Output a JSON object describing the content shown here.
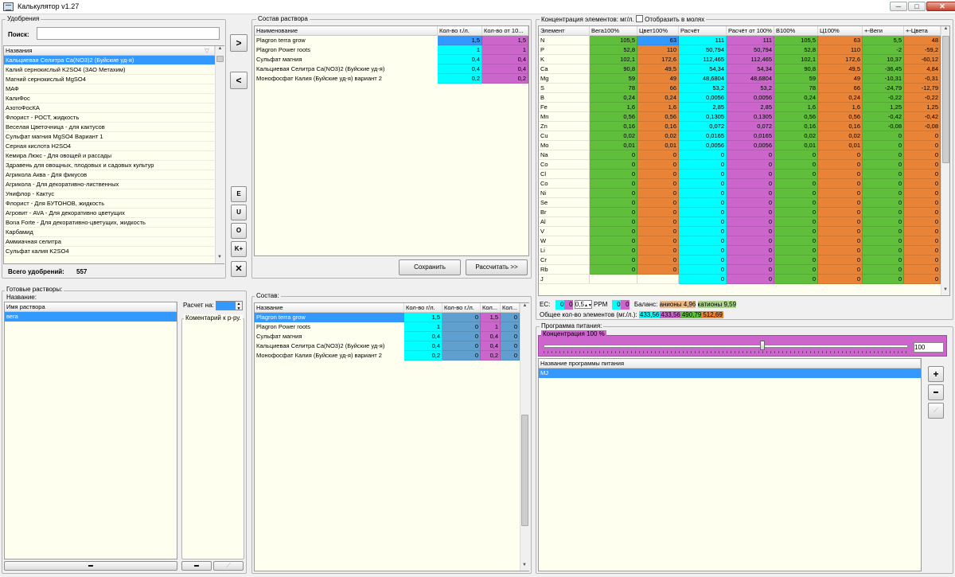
{
  "window": {
    "title": "Калькулятор v1.27",
    "btn_min": "─",
    "btn_max": "□",
    "btn_close": "✕"
  },
  "fert": {
    "group": "Удобрения",
    "search_label": "Поиск:",
    "search_value": "",
    "col": "Названия",
    "items": [
      "Кальциевая Селитра Ca(NO3)2 (Буйские уд-я)",
      "Калий сернокислый K2SO4 (ЗАО Метахим)",
      "Магний сернокислый MgSO4",
      "МАФ",
      "КалиФос",
      "АзотоФосКА",
      "Флорист - РОСТ, жидкость",
      "Веселая Цветочница - для кактусов",
      "Сульфат магния MgSO4 Вариант 1",
      "Серная кислота H2SO4",
      "Кемира Люкс - Для овощей и рассады",
      "Здравень для овощных, плодовых и садовых культур",
      "Агрикола Аква - Для фикусов",
      "Агрикола - Для декоративно-лиственных",
      "Унифлор - Кактус",
      "Флорист - Для БУТОНОВ, жидкость",
      "Агровит - AVA - Для декоративно цветущих",
      "Bona Forte - Для декоративно-цветущих, жидкость",
      "Карбамид",
      "Аммиачная селитра",
      "Сульфат калия K2SO4"
    ],
    "total_label": "Всего удобрений:",
    "total": "557"
  },
  "side_buttons": {
    "add": ">",
    "remove": "<",
    "e": "E",
    "u": "U",
    "o": "O",
    "k": "K+",
    "del": "✕"
  },
  "sostav": {
    "group": "Состав раствора",
    "col1": "Наименование",
    "col2": "Кол-во г./л.",
    "col3": "Кол-во от 10...",
    "rows": [
      {
        "name": "Plagron terra grow",
        "a": "1,5",
        "b": "1,5"
      },
      {
        "name": "Plagron Power roots",
        "a": "1",
        "b": "1"
      },
      {
        "name": "Сульфат магния",
        "a": "0,4",
        "b": "0,4"
      },
      {
        "name": "Кальциевая Селитра Ca(NO3)2 (Буйские уд-я)",
        "a": "0,4",
        "b": "0,4"
      },
      {
        "name": "Монофосфат Калия (Буйские уд-я) вариант 2",
        "a": "0,2",
        "b": "0,2"
      }
    ],
    "save": "Сохранить",
    "calc": "Рассчитать >>"
  },
  "conc": {
    "group": "Концентрация элементов: мг/л.",
    "moles_label": "Отобразить в молях",
    "cols": [
      "Элемент",
      "Вега100%",
      "Цвет100%",
      "Расчёт",
      "Расчёт от 100%",
      "В100%",
      "Ц100%",
      "+-Веги",
      "+-Цвета"
    ],
    "rows": [
      [
        "N",
        "105,5",
        "63",
        "111",
        "111",
        "105,5",
        "63",
        "5,5",
        "48"
      ],
      [
        "P",
        "52,8",
        "110",
        "50,794",
        "50,794",
        "52,8",
        "110",
        "-2",
        "-59,2"
      ],
      [
        "K",
        "102,1",
        "172,6",
        "112,465",
        "112,465",
        "102,1",
        "172,6",
        "10,37",
        "-60,12"
      ],
      [
        "Ca",
        "90,8",
        "49,5",
        "54,34",
        "54,34",
        "90,8",
        "49,5",
        "-36,45",
        "4,84"
      ],
      [
        "Mg",
        "59",
        "49",
        "48,6804",
        "48,6804",
        "59",
        "49",
        "-10,31",
        "-0,31"
      ],
      [
        "S",
        "78",
        "66",
        "53,2",
        "53,2",
        "78",
        "66",
        "-24,79",
        "-12,79"
      ],
      [
        "B",
        "0,24",
        "0,24",
        "0,0056",
        "0,0056",
        "0,24",
        "0,24",
        "-0,22",
        "-0,22"
      ],
      [
        "Fe",
        "1,6",
        "1,6",
        "2,85",
        "2,85",
        "1,6",
        "1,6",
        "1,25",
        "1,25"
      ],
      [
        "Mn",
        "0,56",
        "0,56",
        "0,1305",
        "0,1305",
        "0,56",
        "0,56",
        "-0,42",
        "-0,42"
      ],
      [
        "Zn",
        "0,16",
        "0,16",
        "0,072",
        "0,072",
        "0,16",
        "0,16",
        "-0,08",
        "-0,08"
      ],
      [
        "Cu",
        "0,02",
        "0,02",
        "0,0165",
        "0,0165",
        "0,02",
        "0,02",
        "0",
        "0"
      ],
      [
        "Mo",
        "0,01",
        "0,01",
        "0,0056",
        "0,0056",
        "0,01",
        "0,01",
        "0",
        "0"
      ],
      [
        "Na",
        "0",
        "0",
        "0",
        "0",
        "0",
        "0",
        "0",
        "0"
      ],
      [
        "Co",
        "0",
        "0",
        "0",
        "0",
        "0",
        "0",
        "0",
        "0"
      ],
      [
        "Cl",
        "0",
        "0",
        "0",
        "0",
        "0",
        "0",
        "0",
        "0"
      ],
      [
        "Co",
        "0",
        "0",
        "0",
        "0",
        "0",
        "0",
        "0",
        "0"
      ],
      [
        "Ni",
        "0",
        "0",
        "0",
        "0",
        "0",
        "0",
        "0",
        "0"
      ],
      [
        "Se",
        "0",
        "0",
        "0",
        "0",
        "0",
        "0",
        "0",
        "0"
      ],
      [
        "Br",
        "0",
        "0",
        "0",
        "0",
        "0",
        "0",
        "0",
        "0"
      ],
      [
        "Al",
        "0",
        "0",
        "0",
        "0",
        "0",
        "0",
        "0",
        "0"
      ],
      [
        "V",
        "0",
        "0",
        "0",
        "0",
        "0",
        "0",
        "0",
        "0"
      ],
      [
        "W",
        "0",
        "0",
        "0",
        "0",
        "0",
        "0",
        "0",
        "0"
      ],
      [
        "Li",
        "0",
        "0",
        "0",
        "0",
        "0",
        "0",
        "0",
        "0"
      ],
      [
        "Cr",
        "0",
        "0",
        "0",
        "0",
        "0",
        "0",
        "0",
        "0"
      ],
      [
        "Rb",
        "0",
        "0",
        "0",
        "0",
        "0",
        "0",
        "0",
        "0"
      ],
      [
        "J",
        "",
        "",
        "0",
        "0",
        "0",
        "0",
        "0",
        "0"
      ]
    ]
  },
  "ec": {
    "label": "EC:",
    "v1": "0",
    "v2": "0",
    "ppm_val": "0,5",
    "ppm_label": "PPM",
    "p1": "0",
    "p2": "0",
    "balance_label": "Баланс:",
    "anions": "анионы 4,96",
    "cations": "катионы 9,59",
    "total_label": "Общее кол-во элементов (мг./л.):",
    "t1": "433,56",
    "t2": "433,56",
    "t3": "490,79",
    "t4": "512,69"
  },
  "ready": {
    "group": "Готовые растворы:",
    "name_group": "Название:",
    "col": "Имя раствора",
    "items": [
      "вега"
    ],
    "calc_label": "Расчет на:",
    "calc_value": "",
    "comment_group": "Коментарий к р-ру.",
    "minus": "━",
    "minus2": "━",
    "extra": "⟋"
  },
  "sostav2": {
    "group": "Состав:",
    "cols": [
      "Название",
      "Кол-во г/л.",
      "Кол-во г./л.",
      "Кол...",
      "Кол..."
    ],
    "rows": [
      {
        "name": "Plagron terra grow",
        "a": "1,5",
        "b": "0",
        "c": "1,5",
        "d": "0"
      },
      {
        "name": "Plagron Power roots",
        "a": "1",
        "b": "0",
        "c": "1",
        "d": "0"
      },
      {
        "name": "Сульфат магния",
        "a": "0,4",
        "b": "0",
        "c": "0,4",
        "d": "0"
      },
      {
        "name": "Кальциевая Селитра Ca(NO3)2 (Буйские уд-я)",
        "a": "0,4",
        "b": "0",
        "c": "0,4",
        "d": "0"
      },
      {
        "name": "Монофосфат Калия (Буйские уд-я) вариант 2",
        "a": "0,2",
        "b": "0",
        "c": "0,2",
        "d": "0"
      }
    ]
  },
  "program": {
    "group": "Программа питания:",
    "conc_group": "Концентрация 100 %",
    "slider_value": "100",
    "slider_level": 0.6,
    "col": "Название программы питания",
    "items": [
      "MJ"
    ],
    "plus": "+",
    "minus": "━",
    "extra": "⟋"
  },
  "colors": {
    "cyan": "#00ffff",
    "magenta": "#cc66cc",
    "green": "#5fbf3a",
    "orange": "#e98437",
    "selection": "#3399ff"
  }
}
